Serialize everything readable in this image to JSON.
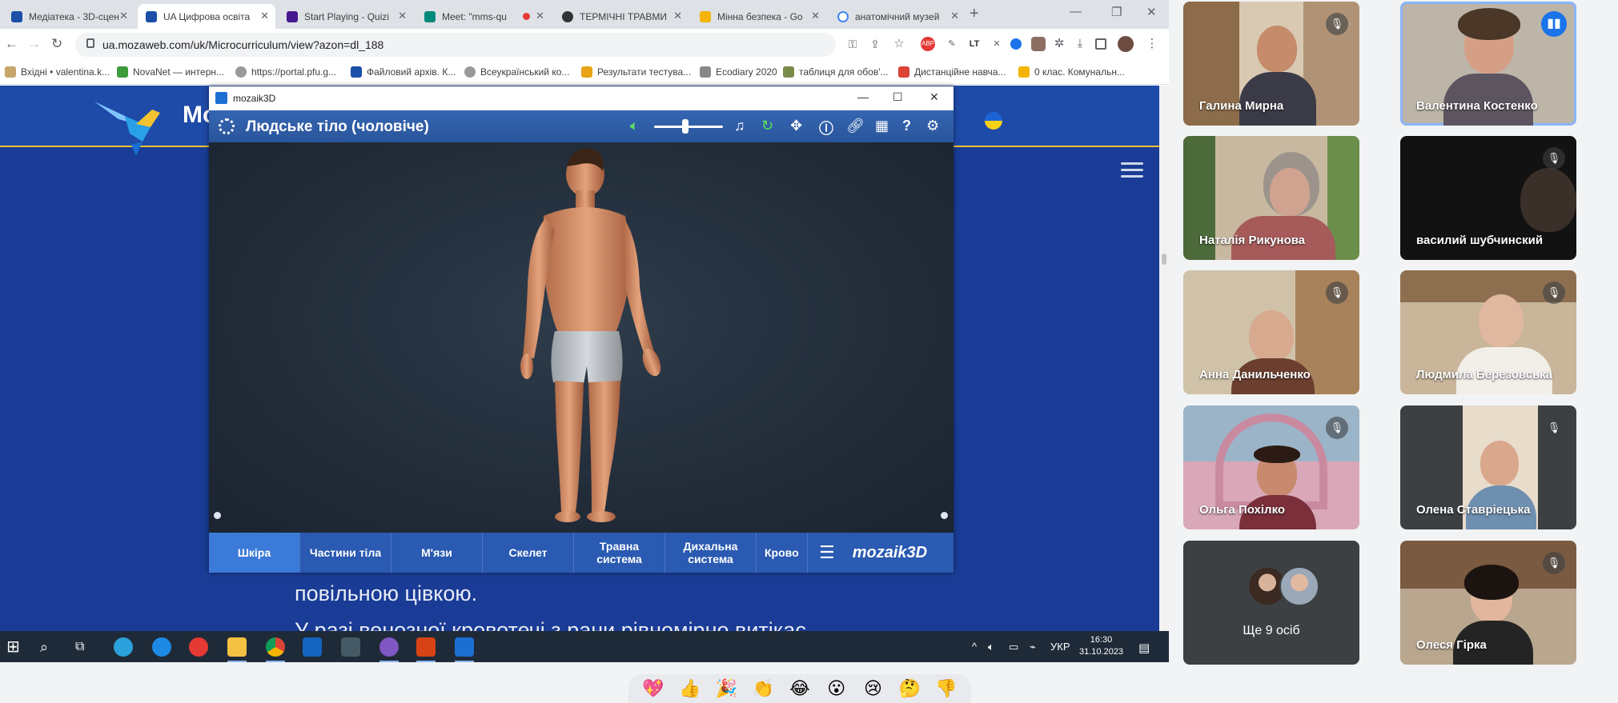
{
  "browser": {
    "tabs": [
      {
        "label": "Медіатека - 3D-сцен",
        "active": false,
        "color": "#1b4fa8"
      },
      {
        "label": "UA Цифрова освіта",
        "active": true,
        "color": "#1b4fa8"
      },
      {
        "label": "Start Playing - Quizi",
        "active": false,
        "color": "#46178f"
      },
      {
        "label": "Meet: \"mms-qu",
        "active": false,
        "color": "#00897b"
      },
      {
        "label": "ТЕРМІЧНІ ТРАВМИ",
        "active": false,
        "color": "#333333"
      },
      {
        "label": "Мінна безпека - Go",
        "active": false,
        "color": "#f4b400"
      },
      {
        "label": "анатомічний музей",
        "active": false,
        "color": "#4285f4"
      }
    ],
    "url": "ua.mozaweb.com/uk/Microcurriculum/view?azon=dl_188",
    "bookmarks": [
      "Вхідні • valentina.k...",
      "NovaNet — интерн...",
      "https://portal.pfu.g...",
      "Файловий архів. К...",
      "Всеукраїнський ко...",
      "Результати тестува...",
      "Ecodiary 2020",
      "таблиця для обов'...",
      "Дистанційне навча...",
      "0 клас. Комунальн..."
    ]
  },
  "page": {
    "logo_text": "Mo",
    "body_line1": "повільною цівкою.",
    "body_line2": "У разі венозної кровотечі з рани рівномірно витікає"
  },
  "mozaik": {
    "window_title": "mozaik3D",
    "scene_title": "Людське тіло (чоловіче)",
    "volume_level": 0.45,
    "categories": [
      {
        "label": "Шкіра",
        "active": true
      },
      {
        "label": "Частини тіла",
        "active": false
      },
      {
        "label": "М'язи",
        "active": false
      },
      {
        "label": "Скелет",
        "active": false
      },
      {
        "label": "Травна система",
        "active": false
      },
      {
        "label": "Дихальна система",
        "active": false
      },
      {
        "label": "Крово",
        "active": false
      }
    ],
    "brand": "mozaik3D"
  },
  "taskbar": {
    "language": "УКР",
    "time": "16:30",
    "date": "31.10.2023"
  },
  "meet": {
    "participants": [
      {
        "name": "Галина Мирна",
        "muted": true,
        "speaking": false
      },
      {
        "name": "Валентина Костенко",
        "muted": false,
        "speaking": true
      },
      {
        "name": "Наталія Рикунова",
        "muted": false,
        "speaking": false
      },
      {
        "name": "василий шубчинский",
        "muted": true,
        "speaking": false
      },
      {
        "name": "Анна Данильченко",
        "muted": true,
        "speaking": false
      },
      {
        "name": "Людмила Березовська",
        "muted": true,
        "speaking": false
      },
      {
        "name": "Ольга Похілко",
        "muted": true,
        "speaking": false
      },
      {
        "name": "Олена Ставріецька",
        "muted": true,
        "speaking": false
      },
      {
        "name": "Олеся Гірка",
        "muted": true,
        "speaking": false
      }
    ],
    "more_label": "Ще 9 осіб",
    "reactions": [
      "💖",
      "👍",
      "🎉",
      "👏",
      "😂",
      "😮",
      "😢",
      "🤔",
      "👎"
    ]
  }
}
